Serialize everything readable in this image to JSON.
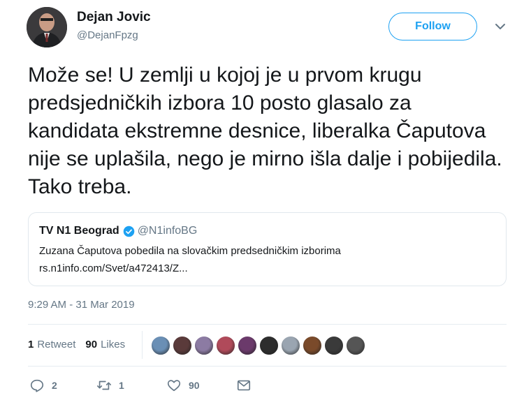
{
  "author": {
    "name": "Dejan Jovic",
    "handle": "@DejanFpzg"
  },
  "follow_label": "Follow",
  "tweet_text": "Može se! U zemlji u kojoj je u prvom krugu predsjedničkih izbora 10 posto glasalo za kandidata ekstremne desnice, liberalka Čaputova nije se uplašila, nego je mirno išla dalje i pobijedila. Tako treba.",
  "quoted": {
    "name": "TV N1 Beograd",
    "handle": "@N1infoBG",
    "text": "Zuzana Čaputova pobedila na slovačkim predsedničkim izborima",
    "link": "rs.n1info.com/Svet/a472413/Z..."
  },
  "timestamp": "9:29 AM - 31 Mar 2019",
  "stats": {
    "retweets_count": "1",
    "retweets_label": "Retweet",
    "likes_count": "90",
    "likes_label": "Likes"
  },
  "likers_colors": [
    "#6a8fb5",
    "#5a3a3a",
    "#8c7ba3",
    "#b04a5a",
    "#6b3a6b",
    "#2d2d2d",
    "#9aa5b1",
    "#7a4a2a",
    "#3a3a3a",
    "#555555"
  ],
  "actions": {
    "reply_count": "2",
    "retweet_count": "1",
    "like_count": "90"
  },
  "colors": {
    "accent": "#1da1f2",
    "secondary_text": "#657786"
  }
}
